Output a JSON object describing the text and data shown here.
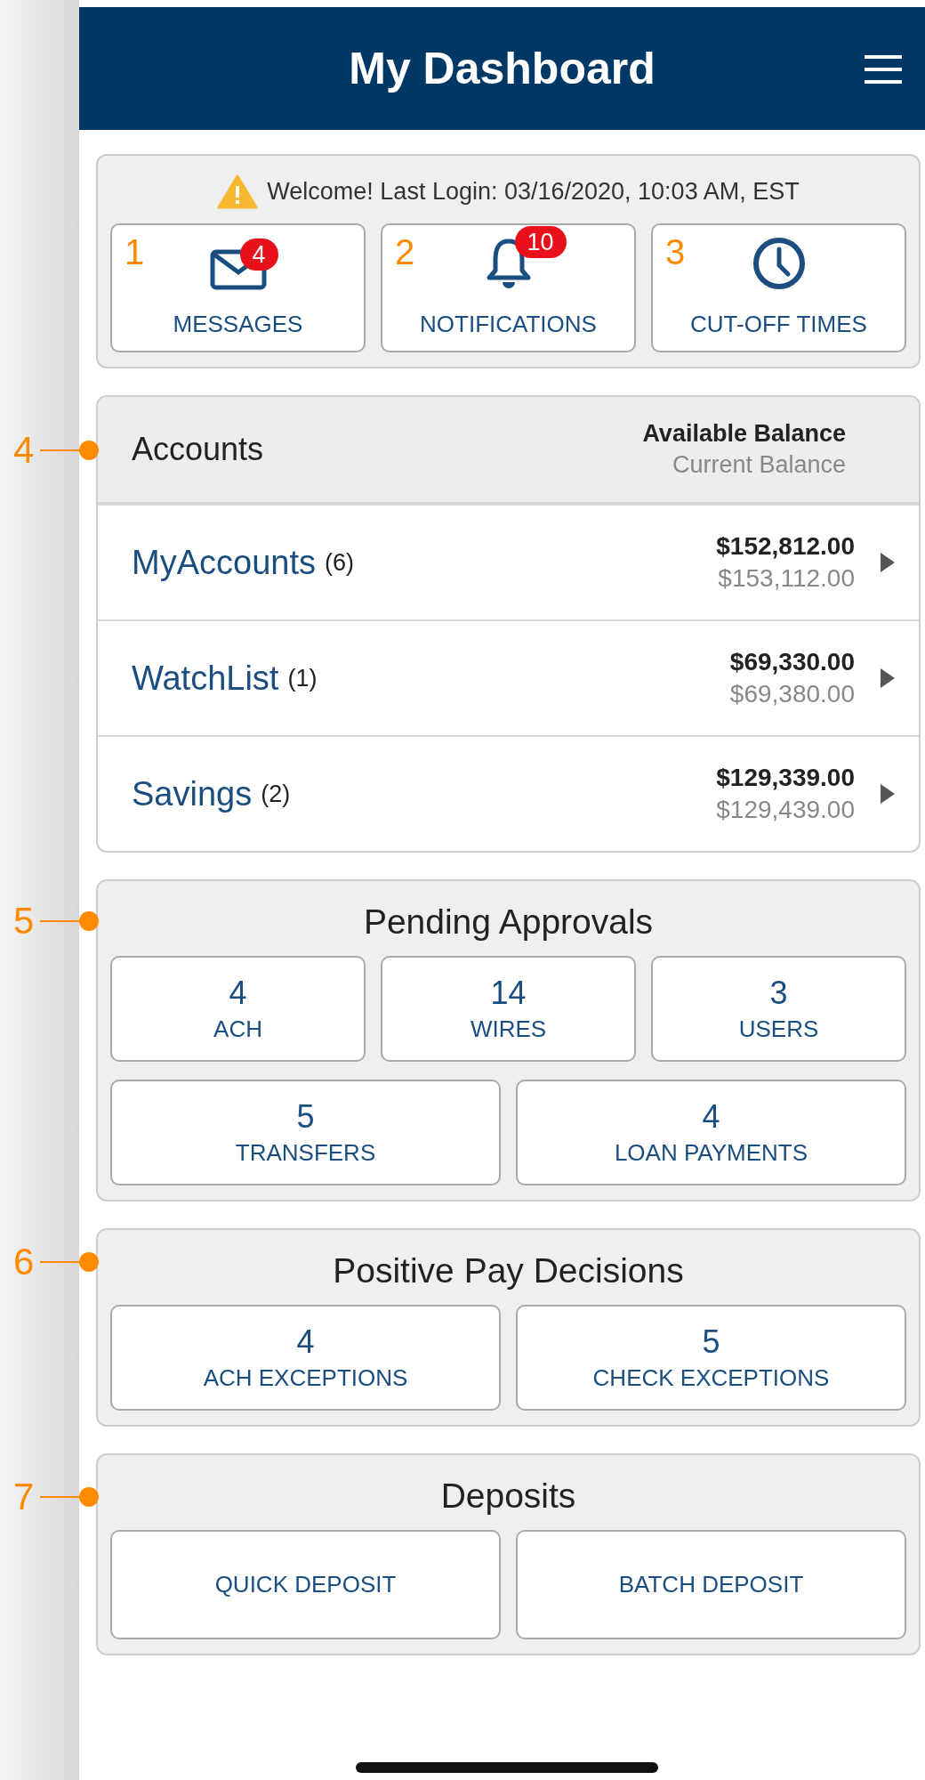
{
  "header": {
    "title": "My Dashboard"
  },
  "welcome": {
    "text": "Welcome! Last Login: 03/16/2020, 10:03 AM, EST"
  },
  "quick_tiles": [
    {
      "kind": "messages",
      "label": "MESSAGES",
      "badge": "4",
      "callout": "1"
    },
    {
      "kind": "notifications",
      "label": "NOTIFICATIONS",
      "badge": "10",
      "callout": "2"
    },
    {
      "kind": "clock",
      "label": "CUT-OFF TIMES",
      "callout": "3"
    }
  ],
  "accounts": {
    "callout": "4",
    "title": "Accounts",
    "column_primary": "Available Balance",
    "column_secondary": "Current Balance",
    "rows": [
      {
        "name": "MyAccounts",
        "count": "(6)",
        "available": "$152,812.00",
        "current": "$153,112.00"
      },
      {
        "name": "WatchList",
        "count": "(1)",
        "available": "$69,330.00",
        "current": "$69,380.00"
      },
      {
        "name": "Savings",
        "count": "(2)",
        "available": "$129,339.00",
        "current": "$129,439.00"
      }
    ]
  },
  "sections": [
    {
      "callout": "5",
      "title": "Pending Approvals",
      "tiles": [
        {
          "count": "4",
          "label": "ACH"
        },
        {
          "count": "14",
          "label": "WIRES"
        },
        {
          "count": "3",
          "label": "USERS"
        },
        {
          "count": "5",
          "label": "TRANSFERS"
        },
        {
          "count": "4",
          "label": "LOAN PAYMENTS"
        }
      ]
    },
    {
      "callout": "6",
      "title": "Positive Pay Decisions",
      "tiles": [
        {
          "count": "4",
          "label": "ACH EXCEPTIONS"
        },
        {
          "count": "5",
          "label": "CHECK EXCEPTIONS"
        }
      ]
    },
    {
      "callout": "7",
      "title": "Deposits",
      "tiles": [
        {
          "label": "QUICK DEPOSIT"
        },
        {
          "label": "BATCH DEPOSIT"
        }
      ]
    }
  ]
}
